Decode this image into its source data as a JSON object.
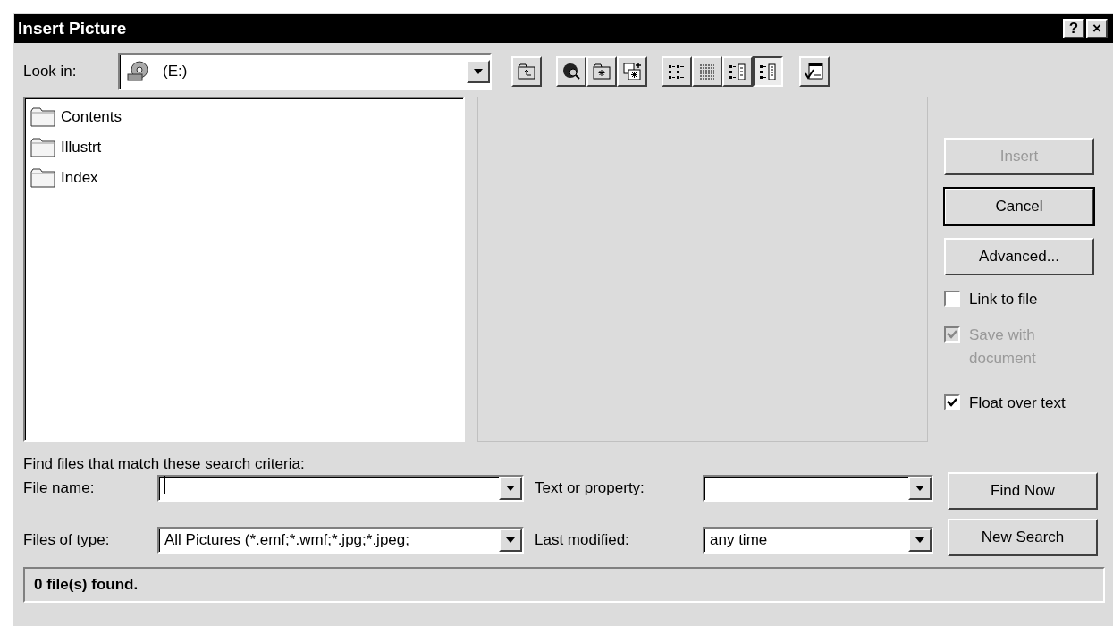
{
  "window": {
    "title": "Insert Picture",
    "title_buttons": [
      "?",
      "×"
    ]
  },
  "look_in": {
    "label": "Look in:",
    "value": "(E:)"
  },
  "toolbar": [
    {
      "kind": "up",
      "selected": false
    },
    {
      "kind": "web",
      "selected": false
    },
    {
      "kind": "new-folder",
      "selected": false
    },
    {
      "kind": "favorites",
      "selected": false
    },
    {
      "kind": "list",
      "selected": false
    },
    {
      "kind": "details",
      "selected": false
    },
    {
      "kind": "properties",
      "selected": false
    },
    {
      "kind": "preview",
      "selected": true
    },
    {
      "kind": "commands",
      "selected": false
    }
  ],
  "files": [
    {
      "name": "Contents"
    },
    {
      "name": "Illustrt"
    },
    {
      "name": "Index"
    }
  ],
  "buttons": [
    {
      "label": "Insert",
      "disabled": true,
      "default": false
    },
    {
      "label": "Cancel",
      "disabled": false,
      "default": true
    },
    {
      "label": "Advanced...",
      "disabled": false,
      "default": false
    }
  ],
  "options": [
    {
      "label": "Link to file",
      "checked": false,
      "disabled": false
    },
    {
      "label": "Save with document",
      "checked": true,
      "disabled": true
    },
    {
      "label": "Float over text",
      "checked": true,
      "disabled": false
    }
  ],
  "search": {
    "heading": "Find files that match these search criteria:",
    "fields": [
      {
        "label": "File name:",
        "caret": true
      },
      {
        "label": "Text or property:"
      },
      {
        "label": "Files of type:",
        "value": "All Pictures (*.emf;*.wmf;*.jpg;*.jpeg;"
      },
      {
        "label": "Last modified:",
        "value": "any time"
      }
    ],
    "buttons": [
      "Find Now",
      "New Search"
    ]
  },
  "status_bar": "0 file(s) found."
}
